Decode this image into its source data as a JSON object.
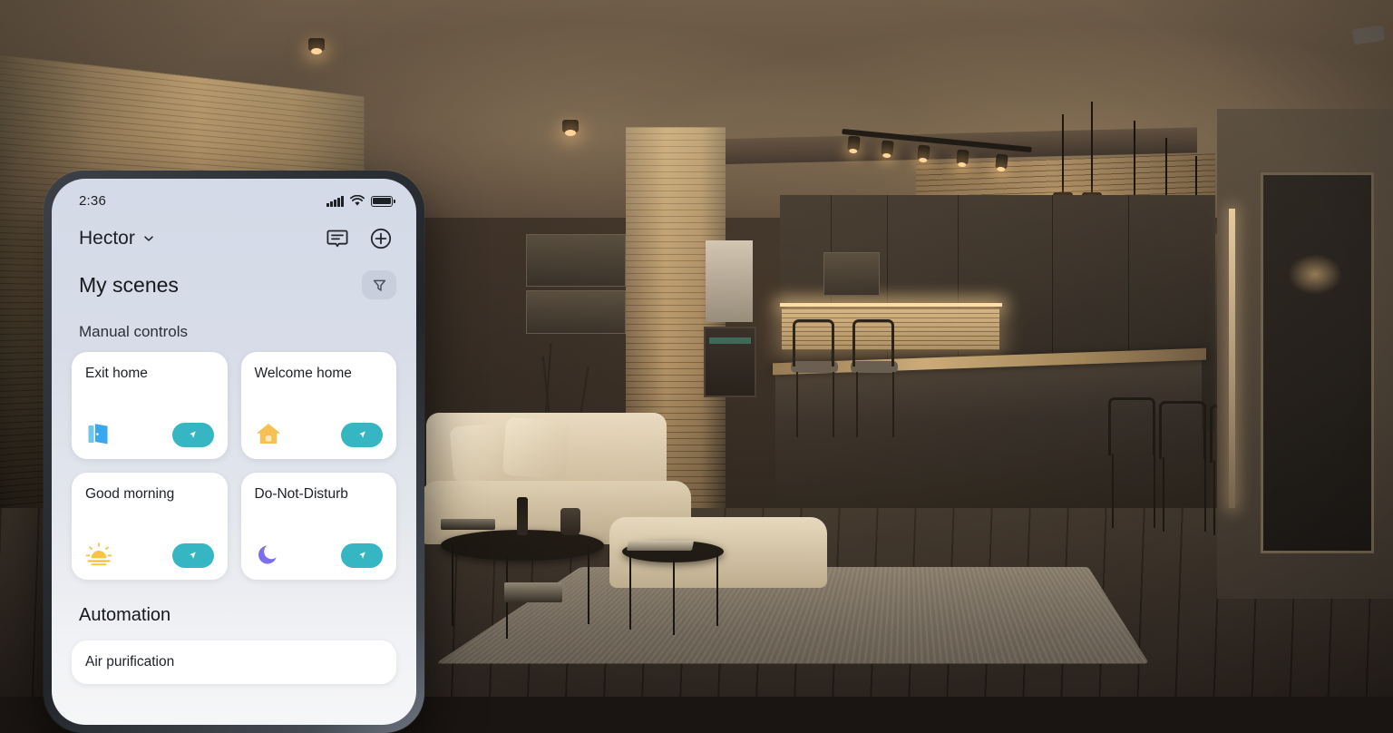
{
  "background": {
    "description": "dimly lit modern open-plan living room and kitchen at night",
    "accent_warm": "#ffd59a"
  },
  "phone": {
    "status_bar": {
      "time": "2:36",
      "signal_icon": "cellular-signal-icon",
      "wifi_icon": "wifi-icon",
      "battery_icon": "battery-full-icon"
    },
    "header": {
      "home_name": "Hector",
      "chevron_icon": "chevron-down-icon",
      "messages_icon": "message-bubble-icon",
      "add_icon": "plus-circle-icon"
    },
    "page_title": "My scenes",
    "filter_icon": "filter-funnel-icon",
    "sections": [
      {
        "label": "Manual controls",
        "cards": [
          {
            "name": "Exit home",
            "icon": "open-door-icon",
            "run_label": "run-scene",
            "run_icon": "cursor-arrow-icon"
          },
          {
            "name": "Welcome home",
            "icon": "house-icon",
            "run_label": "run-scene",
            "run_icon": "cursor-arrow-icon"
          },
          {
            "name": "Good morning",
            "icon": "sunrise-icon",
            "run_label": "run-scene",
            "run_icon": "cursor-arrow-icon"
          },
          {
            "name": "Do-Not-Disturb",
            "icon": "crescent-moon-icon",
            "run_label": "run-scene",
            "run_icon": "cursor-arrow-icon"
          }
        ]
      },
      {
        "label": "Automation",
        "cards": [
          {
            "name": "Air purification",
            "icon": "",
            "run_label": "",
            "run_icon": ""
          }
        ]
      }
    ],
    "colors": {
      "run_button": "#35b6c2",
      "card_background": "#ffffff",
      "screen_top": "#d4dae7",
      "screen_bottom": "#f5f6f8",
      "text_primary": "#1d2127"
    }
  }
}
